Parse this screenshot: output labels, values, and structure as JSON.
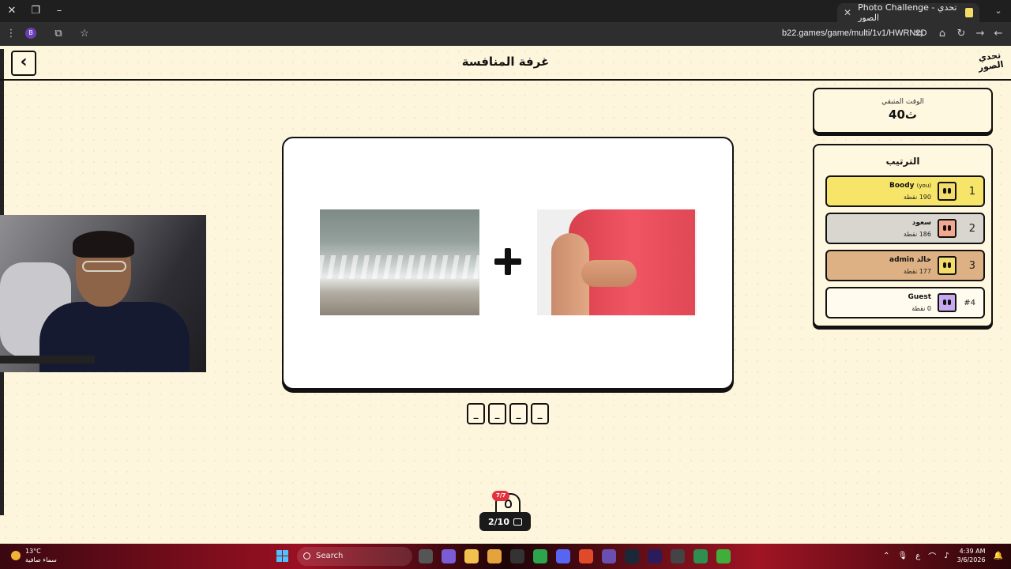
{
  "browser": {
    "tab_title": "Photo Challenge - تحدي الصور",
    "url": "b22.games/game/multi/1v1/HWRN2D",
    "profile_initial": "B"
  },
  "header": {
    "title": "غرفة المنافسة",
    "logo_text": "تحدي الصور",
    "back_icon": "chevron-left-icon"
  },
  "timer": {
    "label": "الوقت المتبقي",
    "value": "40ث"
  },
  "ranking": {
    "title": "الترتيب",
    "players": [
      {
        "position": "1",
        "name": "Boody",
        "you_tag": "(you)",
        "points": "190 نقطة",
        "color": "#f7e56a",
        "avatar_color": "#f3dc6a"
      },
      {
        "position": "2",
        "name": "سعود",
        "you_tag": "",
        "points": "186 نقطة",
        "color": "#d8d6cf",
        "avatar_color": "#f1a88e"
      },
      {
        "position": "3",
        "name": "خالد admin",
        "you_tag": "",
        "points": "177 نقطة",
        "color": "#ddb183",
        "avatar_color": "#f3dc6a"
      },
      {
        "position": "#4",
        "name": "Guest",
        "you_tag": "",
        "points": "0 نقطة",
        "color": "#fffbee",
        "avatar_color": "#c8a8f0"
      }
    ]
  },
  "puzzle": {
    "left_image": "sea-waves-photo",
    "operator": "+",
    "right_image": "itchy-arm-photo"
  },
  "answer_slots": [
    "_",
    "_",
    "_",
    "_"
  ],
  "hint": {
    "badge": "7/7"
  },
  "progress": {
    "label": "2/10"
  },
  "taskbar": {
    "temperature": "13°C",
    "weather": "سماء صافية",
    "search_label": "Search",
    "time": "4:39 AM",
    "date": "3/6/2026",
    "lang": "ع"
  }
}
